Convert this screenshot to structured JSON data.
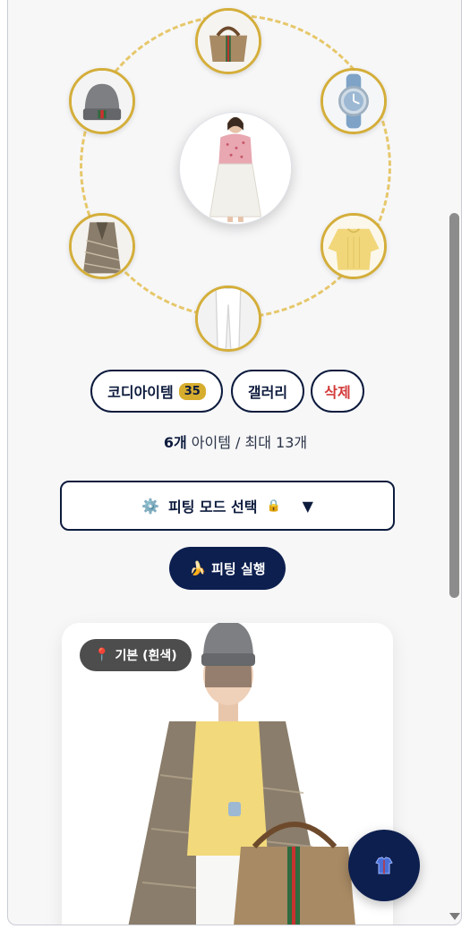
{
  "items": {
    "count_label": "35",
    "buttons": {
      "codi_items": "코디아이템",
      "gallery": "갤러리",
      "delete": "삭제"
    }
  },
  "selection": {
    "count": "6개",
    "rest": " 아이템 / 최대 13개"
  },
  "mode_select": {
    "icon": "⚙️",
    "label": "피팅 모드 선택",
    "lock": "🔒",
    "caret": "▼"
  },
  "run_button": {
    "icon": "🍌",
    "label": "피팅 실행"
  },
  "result": {
    "badge_icon": "📍",
    "badge_label": "기본 (흰색)"
  },
  "colors": {
    "navy": "#0d1f4f",
    "gold": "#d4ae3a",
    "danger": "#d33a3a"
  }
}
